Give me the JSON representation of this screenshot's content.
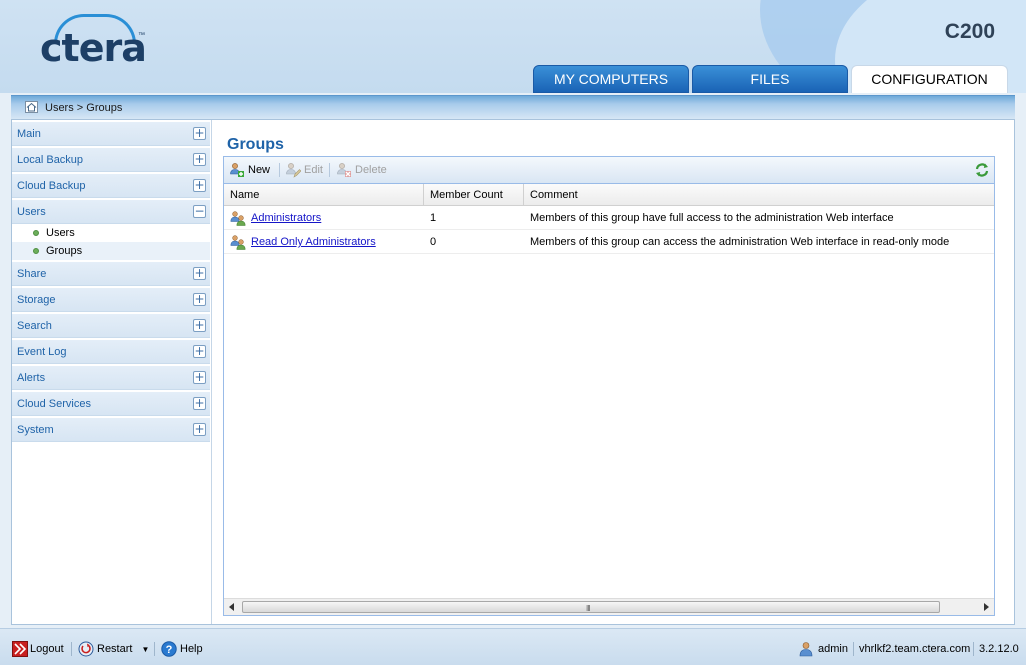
{
  "header": {
    "logo_text": "ctera",
    "logo_tm": "™",
    "model": "C200",
    "tabs": [
      {
        "label": "MY COMPUTERS",
        "active": false
      },
      {
        "label": "FILES",
        "active": false
      },
      {
        "label": "CONFIGURATION",
        "active": true
      }
    ]
  },
  "breadcrumb": {
    "text": "Users > Groups",
    "icon": "home-icon"
  },
  "sidebar": {
    "groups": [
      {
        "label": "Main",
        "toggle": "+"
      },
      {
        "label": "Local Backup",
        "toggle": "+"
      },
      {
        "label": "Cloud Backup",
        "toggle": "+"
      },
      {
        "label": "Users",
        "toggle": "−",
        "children": [
          {
            "label": "Users",
            "selected": false
          },
          {
            "label": "Groups",
            "selected": true
          }
        ]
      },
      {
        "label": "Share",
        "toggle": "+"
      },
      {
        "label": "Storage",
        "toggle": "+"
      },
      {
        "label": "Search",
        "toggle": "+"
      },
      {
        "label": "Event Log",
        "toggle": "+"
      },
      {
        "label": "Alerts",
        "toggle": "+"
      },
      {
        "label": "Cloud Services",
        "toggle": "+"
      },
      {
        "label": "System",
        "toggle": "+"
      }
    ]
  },
  "main": {
    "title": "Groups",
    "toolbar": {
      "new_label": "New",
      "edit_label": "Edit",
      "delete_label": "Delete"
    },
    "table": {
      "columns": [
        "Name",
        "Member Count",
        "Comment"
      ],
      "rows": [
        {
          "name": "Administrators",
          "member_count": "1",
          "comment": "Members of this group have full access to the administration Web interface"
        },
        {
          "name": "Read Only Administrators",
          "member_count": "0",
          "comment": "Members of this group can access the administration Web interface in read-only mode"
        }
      ]
    },
    "scrollbar_grip": "III"
  },
  "footer": {
    "logout_label": "Logout",
    "restart_label": "Restart",
    "help_label": "Help",
    "user": "admin",
    "host": "vhrlkf2.team.ctera.com",
    "version": "3.2.12.0"
  },
  "colors": {
    "accent": "#1f63a8",
    "tab_blue": "#1a63b5",
    "link": "#1515c8"
  }
}
